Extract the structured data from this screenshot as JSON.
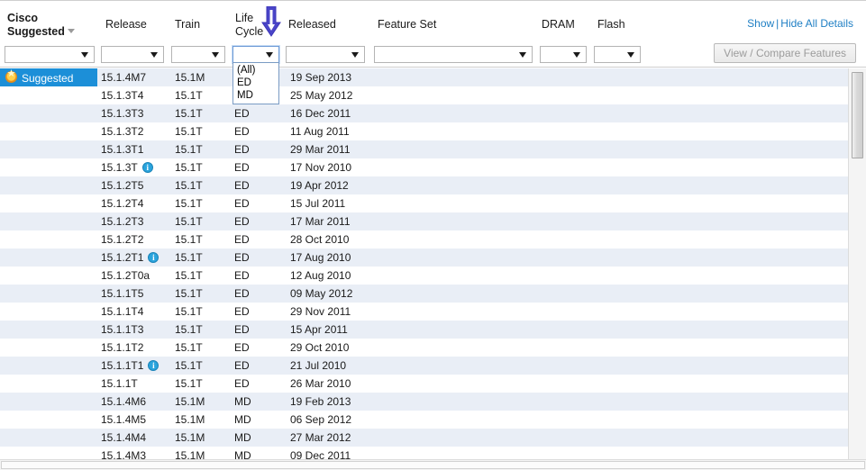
{
  "columns": {
    "suggested": {
      "line1": "Cisco",
      "line2": "Suggested",
      "sortable": true
    },
    "release": {
      "label": "Release"
    },
    "train": {
      "label": "Train"
    },
    "lifecycle": {
      "line1": "Life",
      "line2": "Cycle"
    },
    "released": {
      "label": "Released"
    },
    "featureset": {
      "label": "Feature Set"
    },
    "dram": {
      "label": "DRAM"
    },
    "flash": {
      "label": "Flash"
    }
  },
  "filters": {
    "suggested_value": "",
    "release_value": "",
    "train_value": "",
    "lifecycle_value": "",
    "released_value": "",
    "featureset_value": "",
    "dram_value": "",
    "flash_value": ""
  },
  "lifecycle_dropdown": {
    "open": true,
    "options": [
      "(All)",
      "ED",
      "MD"
    ],
    "selected": ""
  },
  "details_links": {
    "show": "Show",
    "separator": "|",
    "hide_all": "Hide All Details"
  },
  "compare_button": {
    "label": "View / Compare Features",
    "enabled": false
  },
  "annotation": {
    "arrow_color": "#4a45c8",
    "points_to": "lifecycle-filter-select"
  },
  "theme": {
    "row_stripe": "#e9eef6",
    "row_plain": "#ffffff",
    "badge_bg": "#1c8fd8",
    "link_color": "#1f7fc4",
    "info_icon": "#2aa4dd",
    "star_icon": "#e8921f"
  },
  "rows": [
    {
      "suggested": "Suggested",
      "release": "15.1.4M7",
      "train": "15.1M",
      "lifecycle": "",
      "released": "19 Sep 2013",
      "info": false,
      "stripe": true
    },
    {
      "suggested": "",
      "release": "15.1.3T4",
      "train": "15.1T",
      "lifecycle": "",
      "released": "25 May 2012",
      "info": false,
      "stripe": false
    },
    {
      "suggested": "",
      "release": "15.1.3T3",
      "train": "15.1T",
      "lifecycle": "ED",
      "released": "16 Dec 2011",
      "info": false,
      "stripe": true
    },
    {
      "suggested": "",
      "release": "15.1.3T2",
      "train": "15.1T",
      "lifecycle": "ED",
      "released": "11 Aug 2011",
      "info": false,
      "stripe": false
    },
    {
      "suggested": "",
      "release": "15.1.3T1",
      "train": "15.1T",
      "lifecycle": "ED",
      "released": "29 Mar 2011",
      "info": false,
      "stripe": true
    },
    {
      "suggested": "",
      "release": "15.1.3T",
      "train": "15.1T",
      "lifecycle": "ED",
      "released": "17 Nov 2010",
      "info": true,
      "stripe": false
    },
    {
      "suggested": "",
      "release": "15.1.2T5",
      "train": "15.1T",
      "lifecycle": "ED",
      "released": "19 Apr 2012",
      "info": false,
      "stripe": true
    },
    {
      "suggested": "",
      "release": "15.1.2T4",
      "train": "15.1T",
      "lifecycle": "ED",
      "released": "15 Jul 2011",
      "info": false,
      "stripe": false
    },
    {
      "suggested": "",
      "release": "15.1.2T3",
      "train": "15.1T",
      "lifecycle": "ED",
      "released": "17 Mar 2011",
      "info": false,
      "stripe": true
    },
    {
      "suggested": "",
      "release": "15.1.2T2",
      "train": "15.1T",
      "lifecycle": "ED",
      "released": "28 Oct 2010",
      "info": false,
      "stripe": false
    },
    {
      "suggested": "",
      "release": "15.1.2T1",
      "train": "15.1T",
      "lifecycle": "ED",
      "released": "17 Aug 2010",
      "info": true,
      "stripe": true
    },
    {
      "suggested": "",
      "release": "15.1.2T0a",
      "train": "15.1T",
      "lifecycle": "ED",
      "released": "12 Aug 2010",
      "info": false,
      "stripe": false
    },
    {
      "suggested": "",
      "release": "15.1.1T5",
      "train": "15.1T",
      "lifecycle": "ED",
      "released": "09 May 2012",
      "info": false,
      "stripe": true
    },
    {
      "suggested": "",
      "release": "15.1.1T4",
      "train": "15.1T",
      "lifecycle": "ED",
      "released": "29 Nov 2011",
      "info": false,
      "stripe": false
    },
    {
      "suggested": "",
      "release": "15.1.1T3",
      "train": "15.1T",
      "lifecycle": "ED",
      "released": "15 Apr 2011",
      "info": false,
      "stripe": true
    },
    {
      "suggested": "",
      "release": "15.1.1T2",
      "train": "15.1T",
      "lifecycle": "ED",
      "released": "29 Oct 2010",
      "info": false,
      "stripe": false
    },
    {
      "suggested": "",
      "release": "15.1.1T1",
      "train": "15.1T",
      "lifecycle": "ED",
      "released": "21 Jul 2010",
      "info": true,
      "stripe": true
    },
    {
      "suggested": "",
      "release": "15.1.1T",
      "train": "15.1T",
      "lifecycle": "ED",
      "released": "26 Mar 2010",
      "info": false,
      "stripe": false
    },
    {
      "suggested": "",
      "release": "15.1.4M6",
      "train": "15.1M",
      "lifecycle": "MD",
      "released": "19 Feb 2013",
      "info": false,
      "stripe": true
    },
    {
      "suggested": "",
      "release": "15.1.4M5",
      "train": "15.1M",
      "lifecycle": "MD",
      "released": "06 Sep 2012",
      "info": false,
      "stripe": false
    },
    {
      "suggested": "",
      "release": "15.1.4M4",
      "train": "15.1M",
      "lifecycle": "MD",
      "released": "27 Mar 2012",
      "info": false,
      "stripe": true
    },
    {
      "suggested": "",
      "release": "15.1.4M3",
      "train": "15.1M",
      "lifecycle": "MD",
      "released": "09 Dec 2011",
      "info": false,
      "stripe": false
    }
  ]
}
